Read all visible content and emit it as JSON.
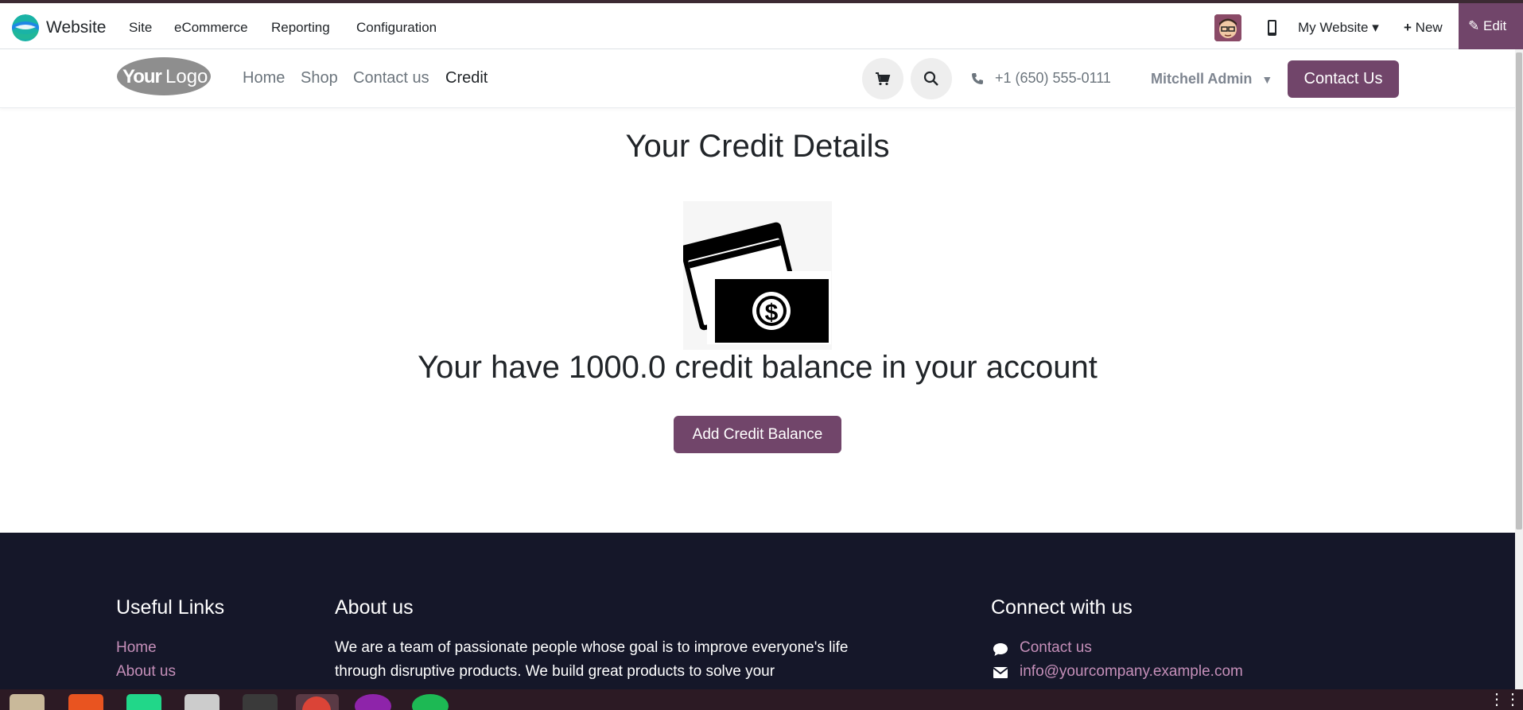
{
  "odoo_bar": {
    "app_name": "Website",
    "menus": [
      "Site",
      "eCommerce",
      "Reporting",
      "Configuration"
    ],
    "my_website": "My Website",
    "new_label": "New",
    "edit_label": "Edit",
    "accent": "#71456a"
  },
  "header": {
    "logo_text": "YourLogo",
    "nav": [
      "Home",
      "Shop",
      "Contact us",
      "Credit"
    ],
    "active_nav": "Credit",
    "phone": "+1 (650) 555-0111",
    "user": "Mitchell Admin",
    "cta": "Contact Us"
  },
  "main": {
    "title": "Your Credit Details",
    "balance_text": "Your have 1000.0 credit balance in your account",
    "add_button": "Add Credit Balance"
  },
  "footer": {
    "useful_links_title": "Useful Links",
    "useful_links": [
      "Home",
      "About us"
    ],
    "about_title": "About us",
    "about_text": "We are a team of passionate people whose goal is to improve everyone's life through disruptive products. We build great products to solve your",
    "connect_title": "Connect with us",
    "connect_links": [
      "Contact us",
      "info@yourcompany.example.com"
    ],
    "background": "#151729",
    "link_color": "#c58fb9"
  }
}
